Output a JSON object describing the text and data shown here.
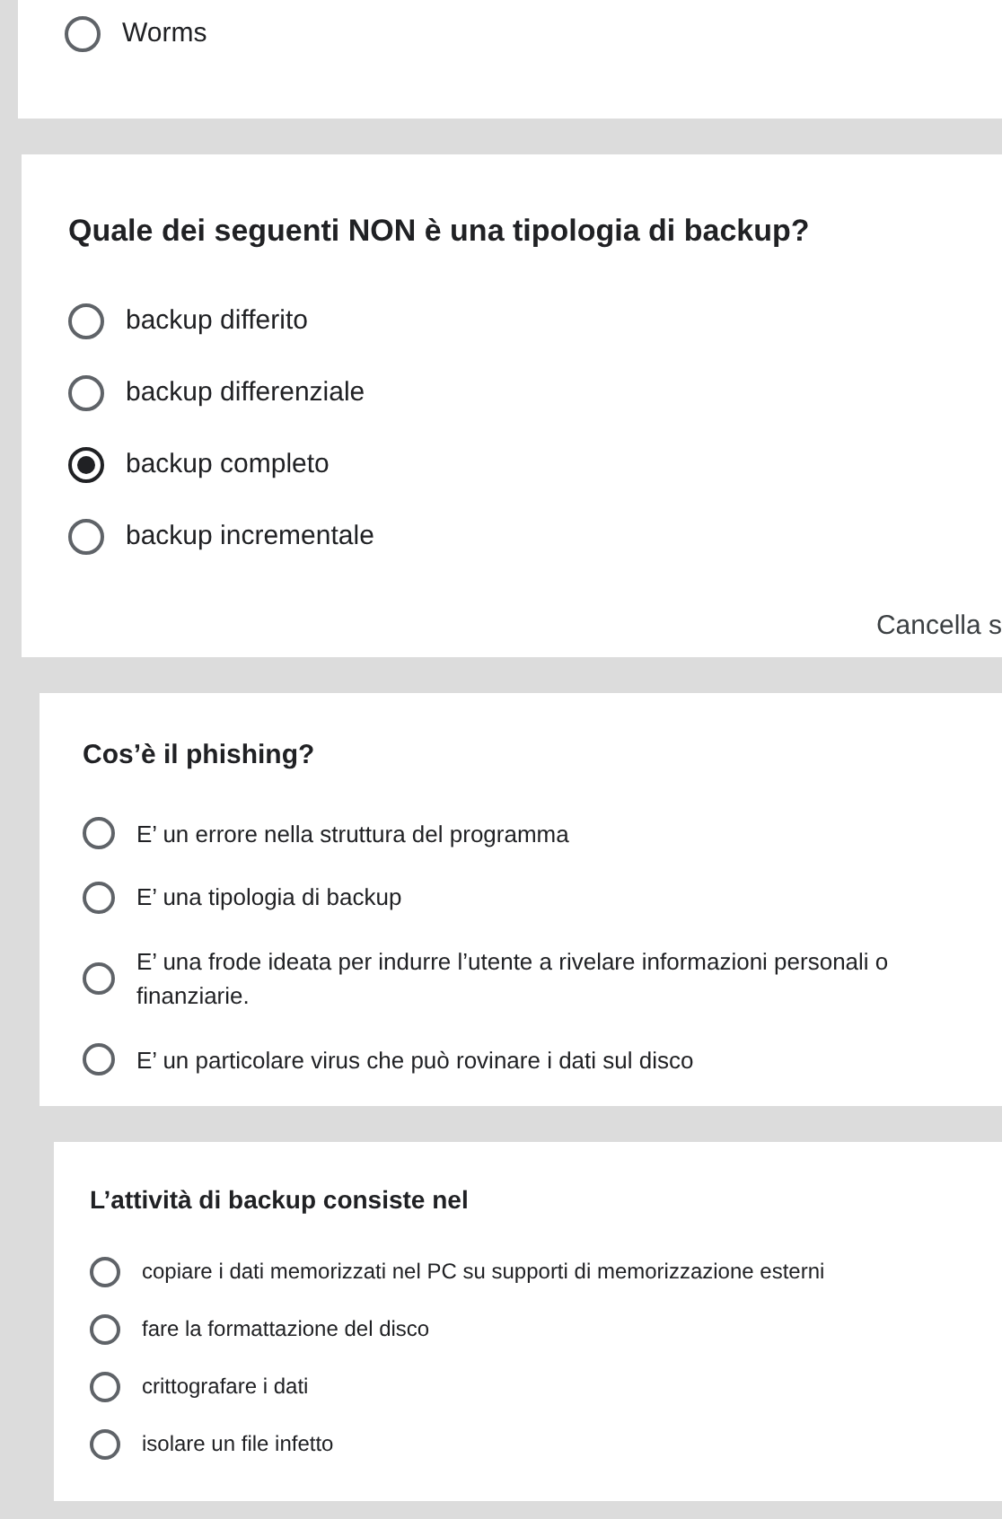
{
  "cards": [
    {
      "options": [
        {
          "label": "Worms",
          "selected": false
        }
      ]
    },
    {
      "question": "Quale dei seguenti NON è una tipologia di backup?",
      "options": [
        {
          "label": "backup differito",
          "selected": false
        },
        {
          "label": "backup differenziale",
          "selected": false
        },
        {
          "label": "backup completo",
          "selected": true
        },
        {
          "label": "backup incrementale",
          "selected": false
        }
      ],
      "clear_link": "Cancella s"
    },
    {
      "question": "Cos’è il phishing?",
      "options": [
        {
          "label": "E’ un errore nella struttura del programma",
          "selected": false
        },
        {
          "label": "E’ una tipologia di backup",
          "selected": false
        },
        {
          "label": "E’ una frode ideata per indurre l’utente a rivelare informazioni personali o finanziarie.",
          "selected": false
        },
        {
          "label": "E’ un particolare virus che può rovinare i dati sul disco",
          "selected": false
        }
      ]
    },
    {
      "question": "L’attività di backup consiste nel",
      "options": [
        {
          "label": "copiare i dati memorizzati nel PC su supporti di memorizzazione esterni",
          "selected": false
        },
        {
          "label": "fare la formattazione del disco",
          "selected": false
        },
        {
          "label": "crittografare i dati",
          "selected": false
        },
        {
          "label": "isolare un file infetto",
          "selected": false
        }
      ]
    }
  ]
}
